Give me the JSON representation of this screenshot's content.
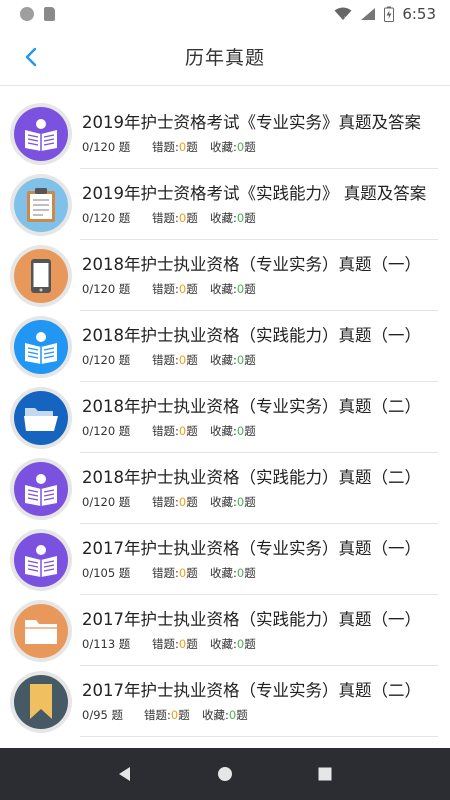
{
  "status_bar": {
    "time": "6:53"
  },
  "header": {
    "title": "历年真题",
    "back_icon": "chevron-left-icon",
    "accent": "#2196f3"
  },
  "labels": {
    "wrong": "错题:",
    "fav": "收藏:"
  },
  "items": [
    {
      "title": "2019年护士资格考试《专业实务》真题及答案",
      "count": "0/120 题",
      "wrong": "0",
      "fav": "0",
      "icon": "book-reader-icon",
      "color": "#7b52e0"
    },
    {
      "title": "2019年护士资格考试《实践能力》 真题及答案",
      "count": "0/120 题",
      "wrong": "0",
      "fav": "0",
      "icon": "clipboard-icon",
      "color": "#7fc1e8"
    },
    {
      "title": "2018年护士执业资格（专业实务）真题（一）",
      "count": "0/120 题",
      "wrong": "0",
      "fav": "0",
      "icon": "phone-icon",
      "color": "#e8985a"
    },
    {
      "title": "2018年护士执业资格（实践能力）真题（一）",
      "count": "0/120 题",
      "wrong": "0",
      "fav": "0",
      "icon": "book-reader-icon",
      "color": "#2196f3"
    },
    {
      "title": "2018年护士执业资格（专业实务）真题（二）",
      "count": "0/120 题",
      "wrong": "0",
      "fav": "0",
      "icon": "folder-open-icon",
      "color": "#1565c0"
    },
    {
      "title": "2018年护士执业资格（实践能力）真题（二）",
      "count": "0/120 题",
      "wrong": "0",
      "fav": "0",
      "icon": "book-reader-icon",
      "color": "#7b52e0"
    },
    {
      "title": "2017年护士执业资格（专业实务）真题（一）",
      "count": "0/105 题",
      "wrong": "0",
      "fav": "0",
      "icon": "book-reader-icon",
      "color": "#7b52e0"
    },
    {
      "title": "2017年护士执业资格（实践能力）真题（一）",
      "count": "0/113 题",
      "wrong": "0",
      "fav": "0",
      "icon": "folder-icon",
      "color": "#e8985a"
    },
    {
      "title": "2017年护士执业资格（专业实务）真题（二）",
      "count": "0/95 题",
      "wrong": "0",
      "fav": "0",
      "icon": "bookmark-icon",
      "color": "#455a64"
    }
  ],
  "nav": {
    "back": "nav-back-icon",
    "home": "nav-home-icon",
    "recents": "nav-recents-icon"
  }
}
